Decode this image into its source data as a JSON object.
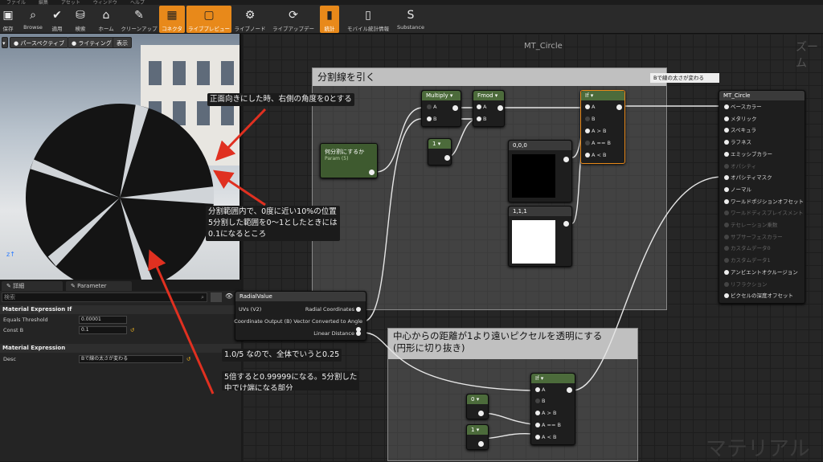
{
  "menubar": [
    "ファイル",
    "編集",
    "アセット",
    "ウィンドウ",
    "ヘルプ"
  ],
  "toolbar": [
    {
      "label": "保存",
      "icon": "save-icon",
      "glyph": "▣"
    },
    {
      "label": "Browse",
      "icon": "browse-icon",
      "glyph": "⌕"
    },
    {
      "label": "適用",
      "icon": "apply-icon",
      "glyph": "✔"
    },
    {
      "label": "検索",
      "icon": "find-icon",
      "glyph": "⛁"
    },
    {
      "label": "ホーム",
      "icon": "home-icon",
      "glyph": "⌂"
    },
    {
      "label": "クリーンアップ",
      "icon": "cleanup-icon",
      "glyph": "✎"
    },
    {
      "label": "コネクタ",
      "icon": "connector-icon",
      "glyph": "▦",
      "active": true
    },
    {
      "label": "ライブプレビュー",
      "icon": "live-preview-icon",
      "glyph": "▢",
      "active": true
    },
    {
      "label": "ライブノード",
      "icon": "live-nodes-icon",
      "glyph": "⚙"
    },
    {
      "label": "ライブアップデート",
      "icon": "live-update-icon",
      "glyph": "⟳"
    },
    {
      "label": "統計",
      "icon": "stats-icon",
      "glyph": "▮",
      "active": true
    },
    {
      "label": "モバイル統計情報",
      "icon": "mobile-stats-icon",
      "glyph": "▯"
    },
    {
      "label": "Substance",
      "icon": "substance-icon",
      "glyph": "S"
    }
  ],
  "viewport": {
    "perspective": "パースペクティブ",
    "lighting": "ライティング",
    "show": "表示"
  },
  "details": {
    "tab_details": "詳細",
    "tab_params": "Parameter Defaults",
    "search_placeholder": "検索",
    "section1": "Material Expression If",
    "equals_threshold_label": "Equals Threshold",
    "equals_threshold_value": "0.00001",
    "const_b_label": "Const B",
    "const_b_value": "0.1",
    "section2": "Material Expression",
    "desc_label": "Desc",
    "desc_value": "Bで線の太さが変わる"
  },
  "graph": {
    "title": "MT_Circle",
    "zoom": "ズーム",
    "watermark": "マテリアル",
    "comment1": "分割線を引く",
    "comment1_tag": "Bで線の太さが変わる",
    "comment2": "中心からの距離が1より遠いピクセルを透明にする\n(円形に切り抜き)",
    "multiply": "Multiply",
    "fmod": "Fmod",
    "if": "If",
    "param_title": "何分割にするか",
    "param_sub": "Param (5)",
    "const_1": "1",
    "const_0": "0",
    "vec000": "0,0,0",
    "vec111": "1,1,1",
    "pin_a": "A",
    "pin_b": "B",
    "pin_gt": "A > B",
    "pin_eq": "A == B",
    "pin_lt": "A < B",
    "radial_title": "RadialValue",
    "radial_in": "UVs (V2)",
    "radial_out1": "Radial Coordinates",
    "radial_in2": "Coordinate Output (B) Vector Converted to Angle",
    "radial_out3": "Linear Distance",
    "result_title": "MT_Circle",
    "result_pins": [
      {
        "label": "ベースカラー",
        "on": true
      },
      {
        "label": "メタリック",
        "on": true
      },
      {
        "label": "スペキュラ",
        "on": true
      },
      {
        "label": "ラフネス",
        "on": true
      },
      {
        "label": "エミッシブカラー",
        "on": true
      },
      {
        "label": "オパシティ",
        "on": false
      },
      {
        "label": "オパシティマスク",
        "on": true
      },
      {
        "label": "ノーマル",
        "on": true
      },
      {
        "label": "ワールドポジションオフセット",
        "on": true
      },
      {
        "label": "ワールドディスプレイスメント",
        "on": false
      },
      {
        "label": "テセレーション乗数",
        "on": false
      },
      {
        "label": "サブサーフェスカラー",
        "on": false
      },
      {
        "label": "カスタムデータ0",
        "on": false
      },
      {
        "label": "カスタムデータ1",
        "on": false
      },
      {
        "label": "アンビエントオクルージョン",
        "on": true
      },
      {
        "label": "リフラクション",
        "on": false
      },
      {
        "label": "ピクセルの深度オフセット",
        "on": true
      }
    ]
  },
  "notes": {
    "n1": "正面向きにした時、右側の角度を0とする",
    "n2": "分割範囲内で、0度に近い10%の位置\n5分割した範囲を0〜1としたときには\n0.1になるところ",
    "n3": "1.0/5 なので、全体でいうと0.25",
    "n4": "5倍すると0.99999になる。5分割した\n中でけ端になる部分"
  },
  "colors": {
    "accent": "#e8891a",
    "arrow": "#e03020",
    "param_header": "#4c6b3b"
  }
}
